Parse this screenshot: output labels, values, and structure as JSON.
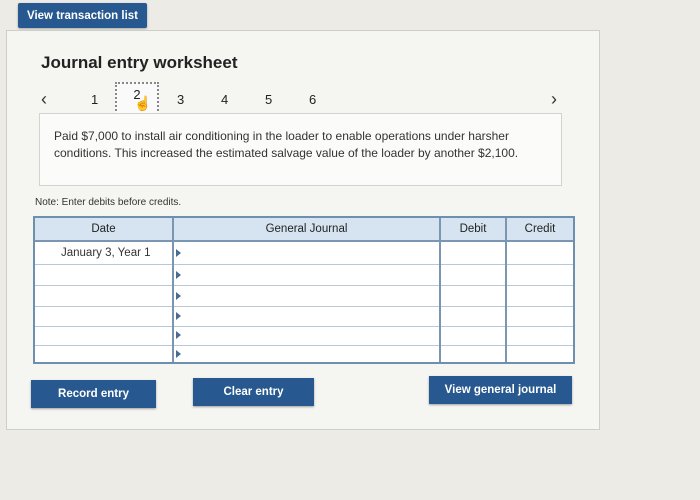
{
  "header": {
    "view_transactions_label": "View transaction list"
  },
  "worksheet": {
    "title": "Journal entry worksheet",
    "nav": {
      "prev_icon": "chevron-left",
      "next_icon": "chevron-right",
      "pages": [
        "1",
        "2",
        "3",
        "4",
        "5",
        "6"
      ],
      "current": "2"
    },
    "description": "Paid $7,000 to install air conditioning in the loader to enable operations under harsher conditions. This increased the estimated salvage value of the loader by another $2,100.",
    "note": "Note: Enter debits before credits."
  },
  "table": {
    "headers": {
      "date": "Date",
      "journal": "General Journal",
      "debit": "Debit",
      "credit": "Credit"
    },
    "rows": [
      {
        "date": "January 3, Year 1",
        "account": "",
        "debit": "",
        "credit": ""
      },
      {
        "date": "",
        "account": "",
        "debit": "",
        "credit": ""
      },
      {
        "date": "",
        "account": "",
        "debit": "",
        "credit": ""
      },
      {
        "date": "",
        "account": "",
        "debit": "",
        "credit": ""
      },
      {
        "date": "",
        "account": "",
        "debit": "",
        "credit": ""
      },
      {
        "date": "",
        "account": "",
        "debit": "",
        "credit": ""
      }
    ]
  },
  "buttons": {
    "record": "Record entry",
    "clear": "Clear entry",
    "view_journal": "View general journal"
  }
}
